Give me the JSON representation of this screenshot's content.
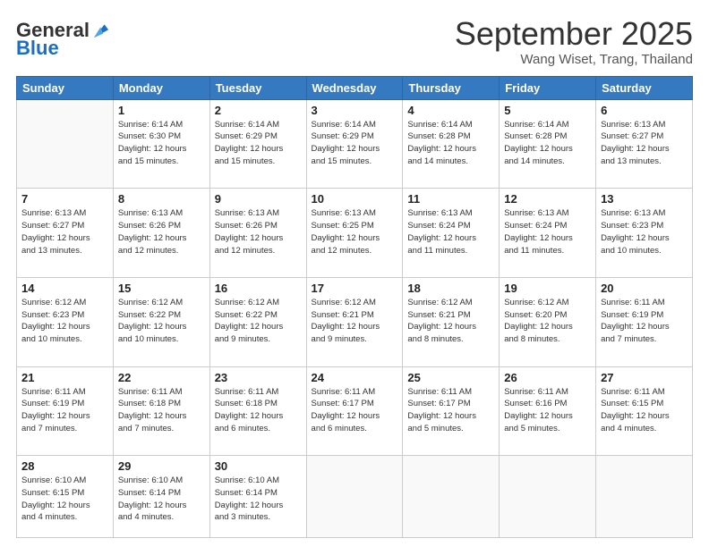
{
  "logo": {
    "general": "General",
    "blue": "Blue"
  },
  "header": {
    "title": "September 2025",
    "subtitle": "Wang Wiset, Trang, Thailand"
  },
  "days_of_week": [
    "Sunday",
    "Monday",
    "Tuesday",
    "Wednesday",
    "Thursday",
    "Friday",
    "Saturday"
  ],
  "weeks": [
    [
      {
        "num": "",
        "info": ""
      },
      {
        "num": "1",
        "info": "Sunrise: 6:14 AM\nSunset: 6:30 PM\nDaylight: 12 hours\nand 15 minutes."
      },
      {
        "num": "2",
        "info": "Sunrise: 6:14 AM\nSunset: 6:29 PM\nDaylight: 12 hours\nand 15 minutes."
      },
      {
        "num": "3",
        "info": "Sunrise: 6:14 AM\nSunset: 6:29 PM\nDaylight: 12 hours\nand 15 minutes."
      },
      {
        "num": "4",
        "info": "Sunrise: 6:14 AM\nSunset: 6:28 PM\nDaylight: 12 hours\nand 14 minutes."
      },
      {
        "num": "5",
        "info": "Sunrise: 6:14 AM\nSunset: 6:28 PM\nDaylight: 12 hours\nand 14 minutes."
      },
      {
        "num": "6",
        "info": "Sunrise: 6:13 AM\nSunset: 6:27 PM\nDaylight: 12 hours\nand 13 minutes."
      }
    ],
    [
      {
        "num": "7",
        "info": "Sunrise: 6:13 AM\nSunset: 6:27 PM\nDaylight: 12 hours\nand 13 minutes."
      },
      {
        "num": "8",
        "info": "Sunrise: 6:13 AM\nSunset: 6:26 PM\nDaylight: 12 hours\nand 12 minutes."
      },
      {
        "num": "9",
        "info": "Sunrise: 6:13 AM\nSunset: 6:26 PM\nDaylight: 12 hours\nand 12 minutes."
      },
      {
        "num": "10",
        "info": "Sunrise: 6:13 AM\nSunset: 6:25 PM\nDaylight: 12 hours\nand 12 minutes."
      },
      {
        "num": "11",
        "info": "Sunrise: 6:13 AM\nSunset: 6:24 PM\nDaylight: 12 hours\nand 11 minutes."
      },
      {
        "num": "12",
        "info": "Sunrise: 6:13 AM\nSunset: 6:24 PM\nDaylight: 12 hours\nand 11 minutes."
      },
      {
        "num": "13",
        "info": "Sunrise: 6:13 AM\nSunset: 6:23 PM\nDaylight: 12 hours\nand 10 minutes."
      }
    ],
    [
      {
        "num": "14",
        "info": "Sunrise: 6:12 AM\nSunset: 6:23 PM\nDaylight: 12 hours\nand 10 minutes."
      },
      {
        "num": "15",
        "info": "Sunrise: 6:12 AM\nSunset: 6:22 PM\nDaylight: 12 hours\nand 10 minutes."
      },
      {
        "num": "16",
        "info": "Sunrise: 6:12 AM\nSunset: 6:22 PM\nDaylight: 12 hours\nand 9 minutes."
      },
      {
        "num": "17",
        "info": "Sunrise: 6:12 AM\nSunset: 6:21 PM\nDaylight: 12 hours\nand 9 minutes."
      },
      {
        "num": "18",
        "info": "Sunrise: 6:12 AM\nSunset: 6:21 PM\nDaylight: 12 hours\nand 8 minutes."
      },
      {
        "num": "19",
        "info": "Sunrise: 6:12 AM\nSunset: 6:20 PM\nDaylight: 12 hours\nand 8 minutes."
      },
      {
        "num": "20",
        "info": "Sunrise: 6:11 AM\nSunset: 6:19 PM\nDaylight: 12 hours\nand 7 minutes."
      }
    ],
    [
      {
        "num": "21",
        "info": "Sunrise: 6:11 AM\nSunset: 6:19 PM\nDaylight: 12 hours\nand 7 minutes."
      },
      {
        "num": "22",
        "info": "Sunrise: 6:11 AM\nSunset: 6:18 PM\nDaylight: 12 hours\nand 7 minutes."
      },
      {
        "num": "23",
        "info": "Sunrise: 6:11 AM\nSunset: 6:18 PM\nDaylight: 12 hours\nand 6 minutes."
      },
      {
        "num": "24",
        "info": "Sunrise: 6:11 AM\nSunset: 6:17 PM\nDaylight: 12 hours\nand 6 minutes."
      },
      {
        "num": "25",
        "info": "Sunrise: 6:11 AM\nSunset: 6:17 PM\nDaylight: 12 hours\nand 5 minutes."
      },
      {
        "num": "26",
        "info": "Sunrise: 6:11 AM\nSunset: 6:16 PM\nDaylight: 12 hours\nand 5 minutes."
      },
      {
        "num": "27",
        "info": "Sunrise: 6:11 AM\nSunset: 6:15 PM\nDaylight: 12 hours\nand 4 minutes."
      }
    ],
    [
      {
        "num": "28",
        "info": "Sunrise: 6:10 AM\nSunset: 6:15 PM\nDaylight: 12 hours\nand 4 minutes."
      },
      {
        "num": "29",
        "info": "Sunrise: 6:10 AM\nSunset: 6:14 PM\nDaylight: 12 hours\nand 4 minutes."
      },
      {
        "num": "30",
        "info": "Sunrise: 6:10 AM\nSunset: 6:14 PM\nDaylight: 12 hours\nand 3 minutes."
      },
      {
        "num": "",
        "info": ""
      },
      {
        "num": "",
        "info": ""
      },
      {
        "num": "",
        "info": ""
      },
      {
        "num": "",
        "info": ""
      }
    ]
  ]
}
